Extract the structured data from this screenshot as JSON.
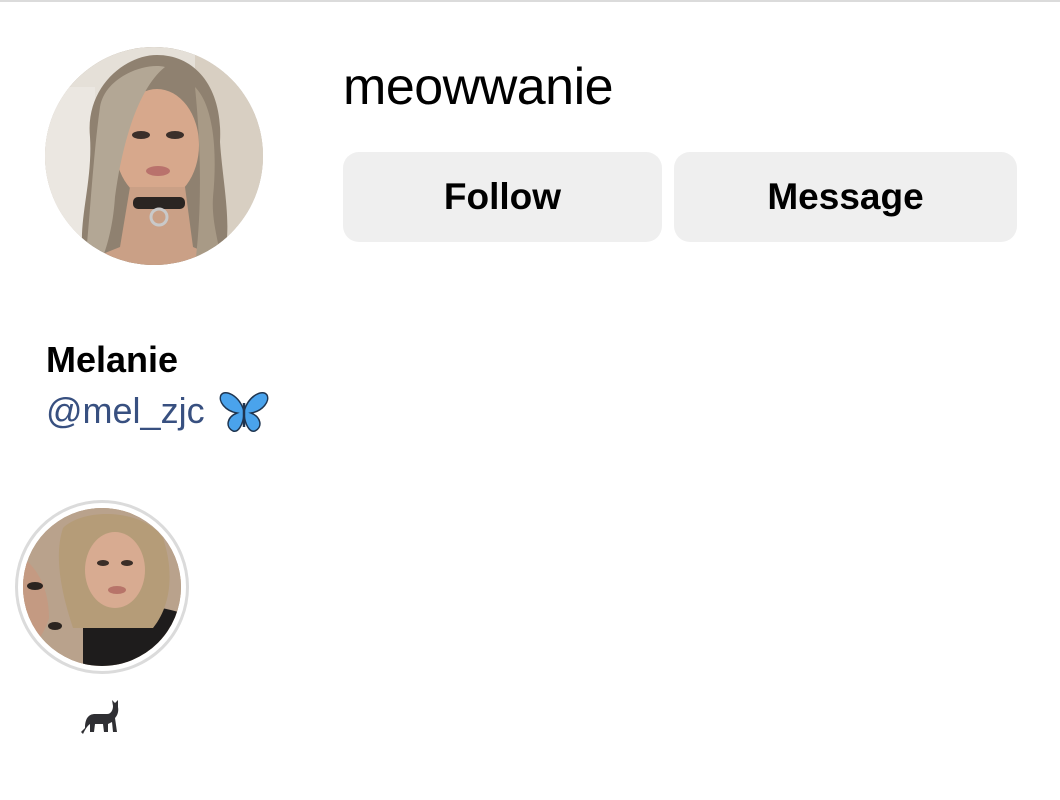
{
  "profile": {
    "username": "meowwanie",
    "display_name": "Melanie",
    "threads_handle": "@mel_zjc",
    "threads_emoji": "butterfly-icon"
  },
  "actions": {
    "follow_label": "Follow",
    "message_label": "Message"
  },
  "highlights": [
    {
      "label_emoji": "cat-icon",
      "label": ""
    }
  ],
  "colors": {
    "button_bg": "#efefef",
    "link_text": "#385080",
    "ring": "#dbdbdb",
    "butterfly": "#4aa3ec"
  }
}
